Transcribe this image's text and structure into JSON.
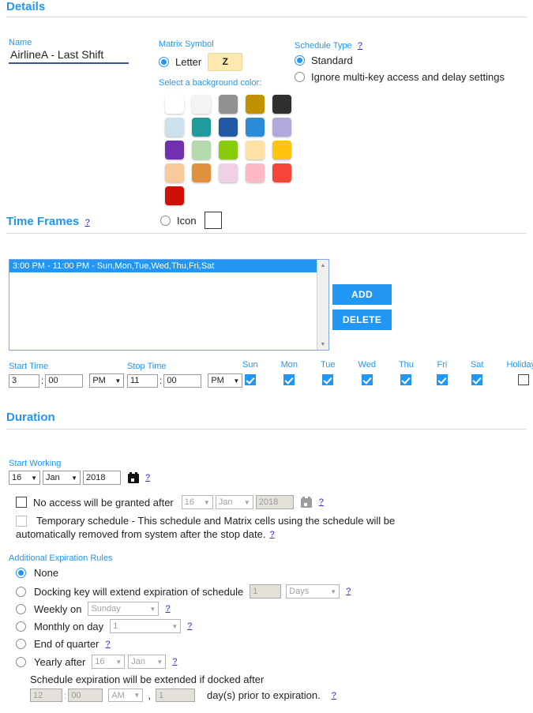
{
  "sections": {
    "details": "Details",
    "time_frames": "Time Frames",
    "duration": "Duration"
  },
  "details": {
    "name_label": "Name",
    "name_value": "AirlineA - Last Shift",
    "matrix_symbol_label": "Matrix Symbol",
    "letter_label": "Letter",
    "letter_value": "Z",
    "background_color_label": "Select a background color:",
    "icon_label": "Icon",
    "schedule_type_label": "Schedule Type",
    "schedule_type_options": [
      "Standard",
      "Ignore multi-key access and delay settings"
    ],
    "schedule_type_selected": "Standard",
    "colors": [
      "#ffffff",
      "#f5f5f5",
      "#8e8e8e",
      "#c49700",
      "#2e2e2e",
      "#cbe0ef",
      "#1f9d9d",
      "#2358a3",
      "#2a8ad4",
      "#b0a8de",
      "#6f2eae",
      "#b3d8ab",
      "#86cc08",
      "#fde1a2",
      "#ffc породы"
    ]
  },
  "color_swatches": [
    "#ffffff",
    "#f4f4f4",
    "#919191",
    "#c09100",
    "#2f2f2f",
    "#cde0ee",
    "#1f9b9b",
    "#2259a4",
    "#2b8bd6",
    "#b1a9dd",
    "#7130ae",
    "#b4d9ac",
    "#87cd09",
    "#fde2a4",
    "#ffc40d",
    "#f7ca9c",
    "#e0913d",
    "#f0d0e5",
    "#ffb9c4",
    "#f74438",
    "#ce1006"
  ],
  "time_frames": {
    "entries": [
      "3:00 PM - 11:00 PM - Sun,Mon,Tue,Wed,Thu,Fri,Sat"
    ],
    "selected_index": 0,
    "add_label": "ADD",
    "delete_label": "DELETE",
    "start_time_label": "Start Time",
    "stop_time_label": "Stop Time",
    "start_hour": "3",
    "start_minute": "00",
    "start_meridiem": "PM",
    "stop_hour": "11",
    "stop_minute": "00",
    "stop_meridiem": "PM",
    "days": [
      {
        "label": "Sun",
        "checked": true
      },
      {
        "label": "Mon",
        "checked": true
      },
      {
        "label": "Tue",
        "checked": true
      },
      {
        "label": "Wed",
        "checked": true
      },
      {
        "label": "Thu",
        "checked": true
      },
      {
        "label": "Fri",
        "checked": true
      },
      {
        "label": "Sat",
        "checked": true
      },
      {
        "label": "Holidays",
        "checked": false
      }
    ]
  },
  "duration": {
    "start_working_label": "Start Working",
    "start_day": "16",
    "start_month": "Jan",
    "start_year": "2018",
    "no_access_label": "No access will be granted after",
    "no_access_checked": false,
    "stop_day": "16",
    "stop_month": "Jan",
    "stop_year": "2018",
    "temporary_label_line1": "Temporary schedule - This schedule and Matrix cells using the schedule will be",
    "temporary_label_line2": "automatically removed from system after the stop date.",
    "temporary_checked": false
  },
  "expiration": {
    "title": "Additional Expiration Rules",
    "selected": "None",
    "options": [
      {
        "label": "None"
      },
      {
        "label": "Docking key will extend expiration of schedule",
        "value": "1",
        "unit": "Days"
      },
      {
        "label": "Weekly on",
        "value": "Sunday"
      },
      {
        "label": "Monthly on day",
        "value": "1"
      },
      {
        "label": "End of quarter"
      },
      {
        "label": "Yearly after",
        "day": "16",
        "month": "Jan"
      }
    ],
    "footer_line1": "Schedule expiration will be extended if docked after",
    "footer_hour": "12",
    "footer_minute": "00",
    "footer_meridiem": "AM",
    "footer_comma": ",",
    "footer_days": "1",
    "footer_tail": "day(s) prior to expiration."
  },
  "icons": {
    "help": "?",
    "dropdown_arrow": "▼",
    "scroll_up": "▲",
    "scroll_down": "▼",
    "calendar": "calendar-icon"
  }
}
